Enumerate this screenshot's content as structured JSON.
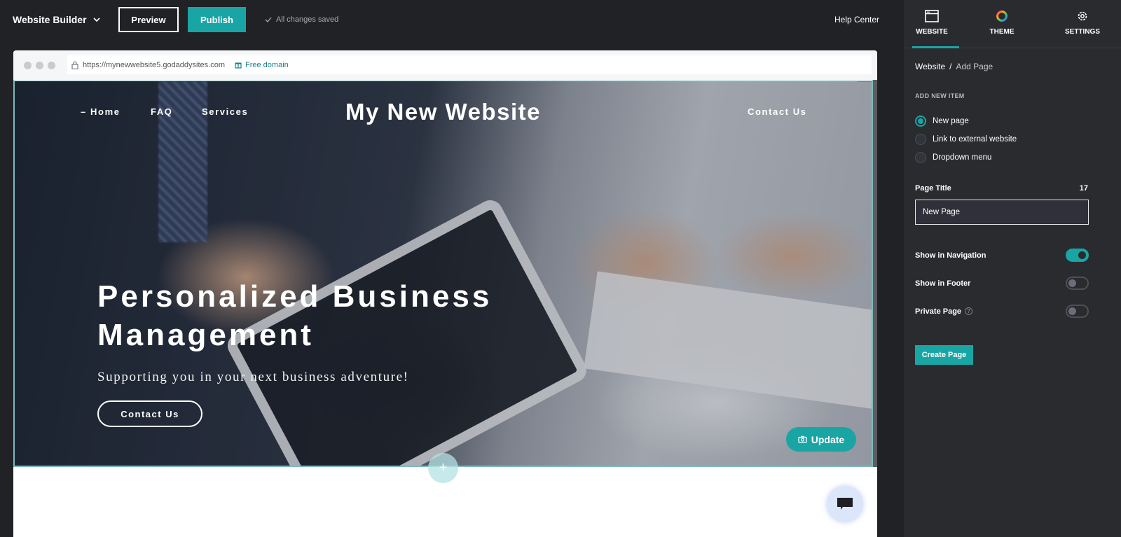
{
  "topbar": {
    "app_title": "Website Builder",
    "preview_label": "Preview",
    "publish_label": "Publish",
    "save_status": "All changes saved",
    "help_label": "Help Center"
  },
  "browser": {
    "url": "https://mynewwebsite5.godaddysites.com",
    "free_domain_label": "Free domain"
  },
  "site": {
    "title": "My New Website",
    "nav": [
      {
        "label": "– Home"
      },
      {
        "label": "FAQ"
      },
      {
        "label": "Services"
      },
      {
        "label": "Contact Us"
      }
    ],
    "headline": "Personalized Business Management",
    "tagline": "Supporting you in your next business adventure!",
    "cta_label": "Contact Us",
    "update_label": "Update",
    "add_section_label": "+"
  },
  "panel": {
    "tabs": [
      {
        "label": "WEBSITE",
        "icon": "browser-window-icon",
        "active": true
      },
      {
        "label": "THEME",
        "icon": "color-wheel-icon",
        "active": false
      },
      {
        "label": "SETTINGS",
        "icon": "gear-icon",
        "active": false
      }
    ],
    "breadcrumb": {
      "root": "Website",
      "separator": "/",
      "current": "Add Page"
    },
    "add_new_item_label": "ADD NEW ITEM",
    "options": [
      {
        "label": "New page",
        "selected": true
      },
      {
        "label": "Link to external website",
        "selected": false
      },
      {
        "label": "Dropdown menu",
        "selected": false
      }
    ],
    "page_title_label": "Page Title",
    "page_title_remaining": "17",
    "page_title_value": "New Page",
    "toggles": [
      {
        "label": "Show in Navigation",
        "on": true
      },
      {
        "label": "Show in Footer",
        "on": false
      },
      {
        "label": "Private Page",
        "on": false,
        "help": "?"
      }
    ],
    "create_label": "Create Page"
  },
  "colors": {
    "accent": "#1aa5a5",
    "chrome_bg": "#212226",
    "panel_bg": "#2a2b2f"
  }
}
